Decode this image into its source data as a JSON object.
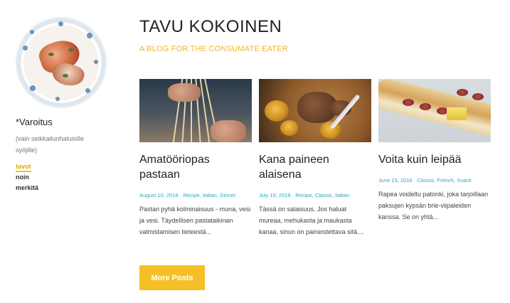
{
  "sidebar": {
    "site_name": "*Varoitus",
    "description": "(vain seikkailunhaluisille syöjille)",
    "nav": [
      {
        "label": "tavut",
        "active": true
      },
      {
        "label": "noin",
        "active": false
      },
      {
        "label": "merkitä",
        "active": false
      }
    ]
  },
  "header": {
    "title": "TAVU KOKOINEN",
    "tagline": "A BLOG FOR THE CONSUMATE EATER"
  },
  "posts": [
    {
      "title": "Amatööriopas pastaan",
      "date": "August 10, 2016",
      "tags": [
        "Recipe",
        "Italian",
        "Dinner"
      ],
      "excerpt": "Pastan pyhä kolminaisuus - muna, vesi ja vesi. Täydellisen pastataikinan valmistamisen tieteestä..."
    },
    {
      "title": "Kana paineen alaisena",
      "date": "July 10, 2016",
      "tags": [
        "Recipe",
        "Classic",
        "Italian"
      ],
      "excerpt": "Tässä on salaisuus. Jos haluat mureaa, mehukasta ja maukasta kanaa, sinun on paineistettava sitä...."
    },
    {
      "title": "Voita kuin leipää",
      "date": "June 23, 2016",
      "tags": [
        "Classic",
        "French",
        "Snack"
      ],
      "excerpt": "Rapea voideltu patonki, joka tarjoillaan paksujen kypsän brie-viipaleiden kanssa. Se on yhtä..."
    }
  ],
  "more_button": "More Posts",
  "colors": {
    "accent": "#f4c026",
    "meta": "#2aa7c8",
    "text": "#333333"
  }
}
